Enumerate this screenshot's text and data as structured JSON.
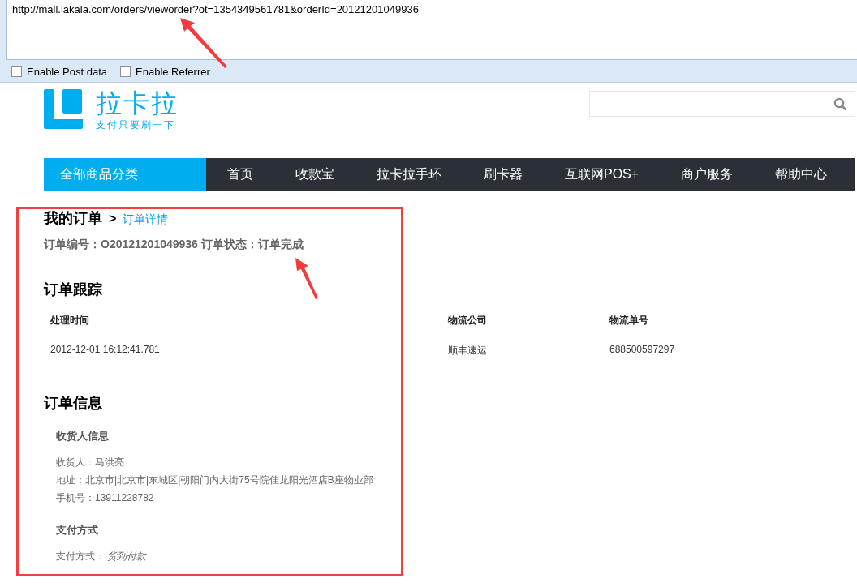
{
  "url_bar": {
    "value": "http://mall.lakala.com/orders/vieworder?ot=1354349561781&orderId=20121201049936"
  },
  "options": [
    {
      "label": "Enable Post data",
      "checked": false
    },
    {
      "label": "Enable Referrer",
      "checked": false
    }
  ],
  "logo": {
    "name": "拉卡拉",
    "tagline": "支付只要刷一下"
  },
  "nav": [
    {
      "label": "全部商品分类",
      "kind": "category"
    },
    {
      "label": "首页",
      "kind": "link"
    },
    {
      "label": "收款宝",
      "kind": "link"
    },
    {
      "label": "拉卡拉手环",
      "kind": "link"
    },
    {
      "label": "刷卡器",
      "kind": "link"
    },
    {
      "label": "互联网POS+",
      "kind": "link"
    },
    {
      "label": "商户服务",
      "kind": "link"
    },
    {
      "label": "帮助中心",
      "kind": "link"
    }
  ],
  "breadcrumb": {
    "parent": "我的订单",
    "separator": ">",
    "current": "订单详情"
  },
  "order_summary": "订单编号：O20121201049936 订单状态：订单完成",
  "tracking": {
    "title": "订单跟踪",
    "columns": [
      "处理时间",
      "物流公司",
      "物流单号"
    ],
    "rows": [
      [
        "2012-12-01 16:12:41.781",
        "顺丰速运",
        "688500597297"
      ]
    ]
  },
  "info": {
    "title": "订单信息",
    "sections": [
      {
        "title": "收货人信息",
        "lines": [
          "收货人：马洪亮",
          "地址：北京市|北京市|东城区|朝阳门内大街75号院佳龙阳光酒店B座物业部",
          "手机号：13911228782"
        ]
      },
      {
        "title": "支付方式",
        "lines": [
          "支付方式： *货到付款*"
        ]
      }
    ]
  }
}
